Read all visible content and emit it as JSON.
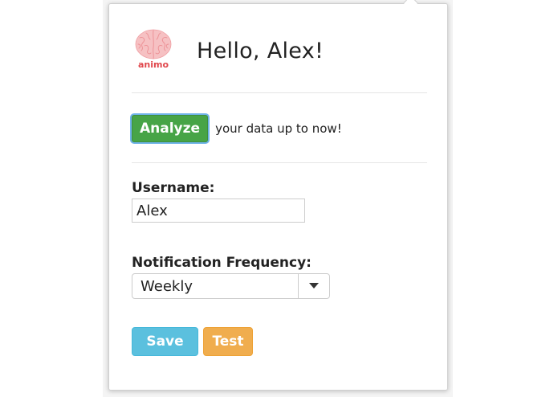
{
  "header": {
    "logo_text": "animo",
    "greeting": "Hello, Alex!"
  },
  "analyze": {
    "button_label": "Analyze",
    "suffix_text": "your data up to now!"
  },
  "username": {
    "label": "Username:",
    "value": "Alex"
  },
  "notification": {
    "label": "Notification Frequency:",
    "selected": "Weekly"
  },
  "actions": {
    "save_label": "Save",
    "test_label": "Test"
  },
  "colors": {
    "analyze_green": "#47a447",
    "save_blue": "#5bc0de",
    "test_orange": "#f0ad4e",
    "logo_red": "#e0474c",
    "logo_pink": "#f6c1c3"
  },
  "icons": {
    "logo": "brain-icon",
    "dropdown": "caret-down-icon"
  }
}
